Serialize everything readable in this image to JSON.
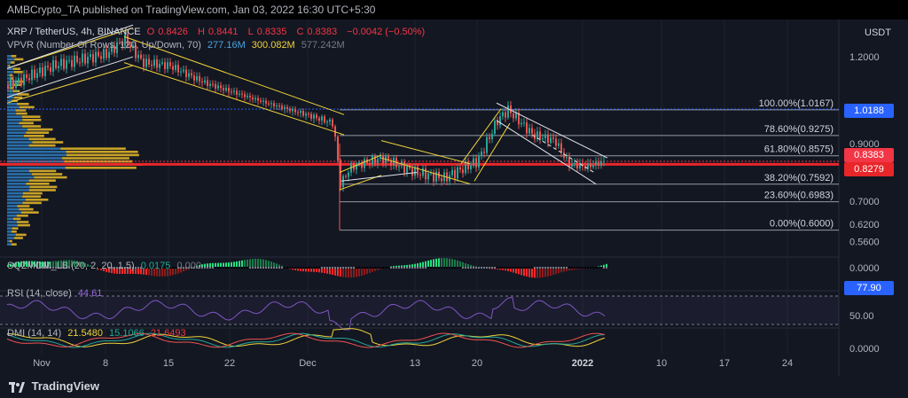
{
  "header": {
    "publisher_line": "AMBCrypto_TA published on TradingView.com, Jan 03, 2022 16:30 UTC+5:30"
  },
  "legend": {
    "symbol": "XRP / TetherUS, 4h, BINANCE",
    "o_label": "O",
    "o_value": "0.8426",
    "h_label": "H",
    "h_value": "0.8441",
    "l_label": "L",
    "l_value": "0.8335",
    "c_label": "C",
    "c_value": "0.8383",
    "change": "−0.0042 (−0.50%)",
    "vpvr_label": "VPVR (Number Of Rows, 120, Up/Down, 70)",
    "vpvr_v1": "277.16M",
    "vpvr_v2": "300.082M",
    "vpvr_v3": "577.242M",
    "sqz_label": "SQZMOM_LB (20, 2, 20, 1.5)",
    "sqz_value": "0.0175",
    "sqz_value2": "0.000",
    "rsi_label": "RSI (14, close)",
    "rsi_value": "44.61",
    "dmi_label": "DMI (14, 14)",
    "dmi_v1": "21.5480",
    "dmi_v2": "15.1066",
    "dmi_v3": "21.6493"
  },
  "axis": {
    "currency": "USDT",
    "price_ticks": [
      "1.2000",
      "0.9000",
      "0.7000",
      "0.6200",
      "0.5600"
    ],
    "current_price_tag": "0.8383",
    "upper_price_tag": "1.0188",
    "support_price_tag": "0.8279",
    "sqz_tick": "0.0000",
    "rsi_tag": "77.90",
    "rsi_tick": "50.00",
    "dmi_tick": "0.0000",
    "time_labels": [
      "Nov",
      "8",
      "15",
      "22",
      "Dec",
      "13",
      "20",
      "2022",
      "10",
      "17",
      "24"
    ]
  },
  "fib": [
    "100.00%(1.0167)",
    "78.60%(0.9275)",
    "61.80%(0.8575)",
    "38.20%(0.7592)",
    "23.60%(0.6983)",
    "0.00%(0.6000)"
  ],
  "brand": {
    "name": "TradingView"
  },
  "colors": {
    "bg": "#131722",
    "up": "#26a69a",
    "down": "#ef5350",
    "support": "#e8262a",
    "fib": "#9598a1",
    "channel": "#f0d33a",
    "rsi": "#7e57c2",
    "blue": "#2962ff"
  },
  "chart_data": {
    "type": "line",
    "title": "XRP / TetherUS, 4h, BINANCE",
    "x": [
      "Nov 1",
      "Nov 8",
      "Nov 10",
      "Nov 15",
      "Nov 22",
      "Dec 1",
      "Dec 4",
      "Dec 13",
      "Dec 20",
      "Dec 23",
      "Jan 1",
      "Jan 3"
    ],
    "series": [
      {
        "values": [
          1.1,
          1.2,
          1.25,
          1.18,
          1.09,
          1.0,
          0.76,
          0.8,
          0.85,
          1.0167,
          0.82,
          0.8383
        ]
      }
    ],
    "ylim": [
      0.55,
      1.34
    ],
    "xlabel": "",
    "ylabel": "",
    "fib_levels": [
      {
        "label": "100.00%",
        "value": 1.0167
      },
      {
        "label": "78.60%",
        "value": 0.9275
      },
      {
        "label": "61.80%",
        "value": 0.8575
      },
      {
        "label": "38.20%",
        "value": 0.7592
      },
      {
        "label": "23.60%",
        "value": 0.6983
      },
      {
        "label": "0.00%",
        "value": 0.6
      }
    ],
    "support_line": 0.8279,
    "last_close": 0.8383,
    "rsi_last": 44.61,
    "indicators": [
      "VPVR",
      "SQZMOM_LB",
      "RSI",
      "DMI"
    ]
  }
}
